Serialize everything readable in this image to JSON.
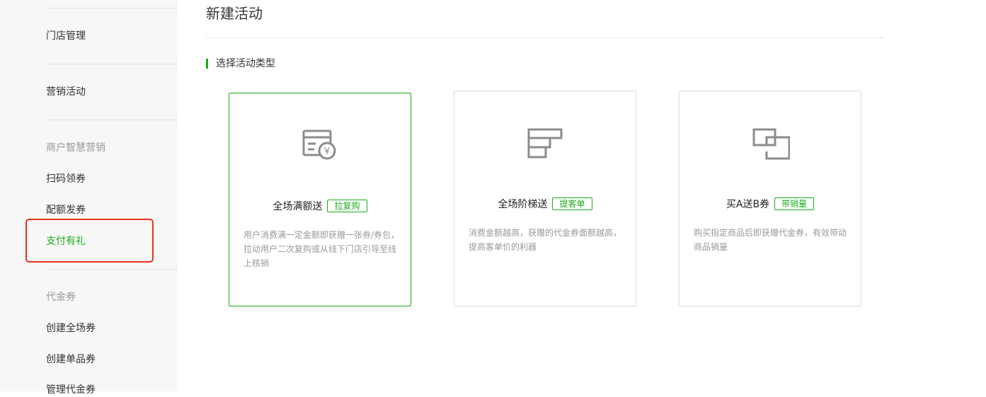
{
  "sidebar": {
    "items": [
      {
        "label": "门店管理"
      },
      {
        "label": "营销活动"
      },
      {
        "label": "扫码领券"
      },
      {
        "label": "配额发券"
      },
      {
        "label": "支付有礼"
      },
      {
        "label": "创建全场券"
      },
      {
        "label": "创建单品券"
      },
      {
        "label": "管理代金券"
      }
    ],
    "sections": [
      {
        "label": "商户智慧营销"
      },
      {
        "label": "代金券"
      }
    ],
    "active_item": "支付有礼"
  },
  "main": {
    "title": "新建活动",
    "section_title": "选择活动类型",
    "cards": [
      {
        "title": "全场满额送",
        "tag": "拉复购",
        "desc": "用户消费满一定金额即获赠一张券/券包，拉动用户二次复购或从线下门店引导至线上核销",
        "icon": "voucher-yen-icon",
        "selected": true
      },
      {
        "title": "全场阶梯送",
        "tag": "提客单",
        "desc": "消费金额越高，获赠的代金券面额越高，提高客单价的利器",
        "icon": "ladder-steps-icon",
        "selected": false
      },
      {
        "title": "买A送B券",
        "tag": "带销量",
        "desc": "购买指定商品后即获赠代金券，有效带动商品销量",
        "icon": "overlap-squares-icon",
        "selected": false
      }
    ]
  },
  "colors": {
    "accent": "#1aad19",
    "highlight": "#e8311a",
    "sidebar_bg": "#f7f7f7"
  }
}
